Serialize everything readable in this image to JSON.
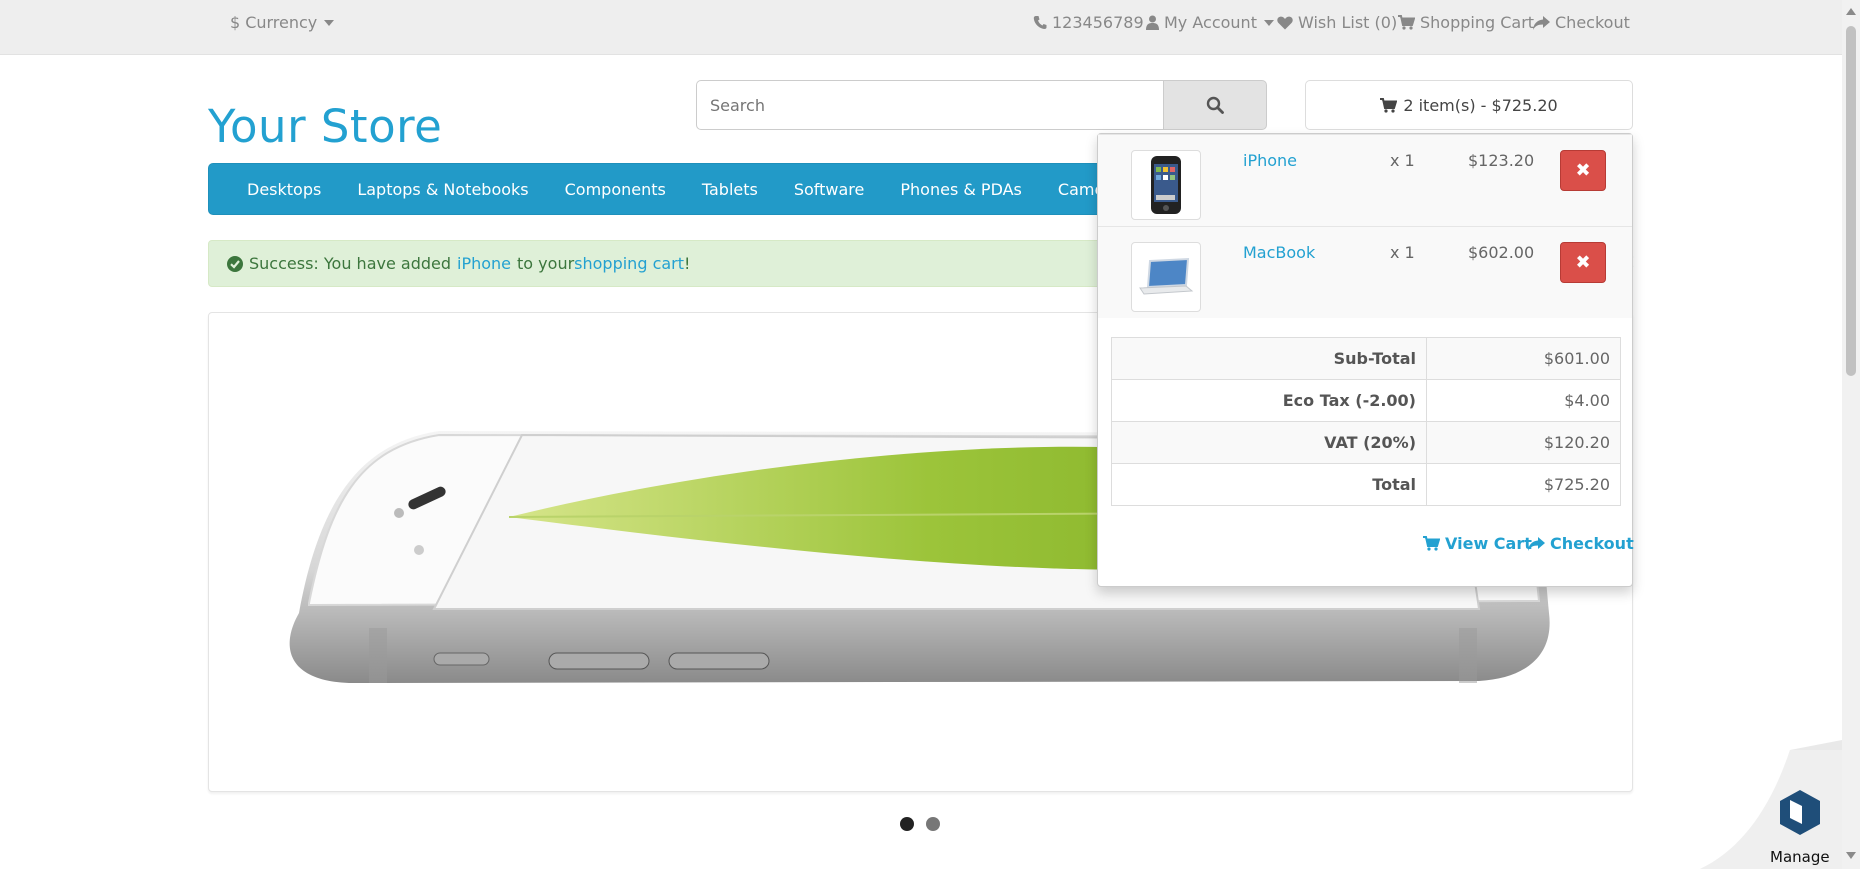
{
  "topbar": {
    "currency_label": "Currency",
    "currency_symbol": "$",
    "phone": "123456789",
    "my_account": "My Account",
    "wish_list": "Wish List (0)",
    "shopping_cart": "Shopping Cart",
    "checkout": "Checkout"
  },
  "header": {
    "logo": "Your Store",
    "search_placeholder": "Search",
    "cart_summary": "2 item(s) - $725.20"
  },
  "menu": {
    "items": [
      "Desktops",
      "Laptops & Notebooks",
      "Components",
      "Tablets",
      "Software",
      "Phones & PDAs",
      "Cameras"
    ]
  },
  "alert": {
    "prefix": "Success: You have added",
    "product": "iPhone",
    "middle": "to your",
    "cart_link": "shopping cart",
    "suffix": "!",
    "close": "×"
  },
  "cart": {
    "items": [
      {
        "name": "iPhone",
        "qty": "x 1",
        "price": "$123.20",
        "remove": "✖"
      },
      {
        "name": "MacBook",
        "qty": "x 1",
        "price": "$602.00",
        "remove": "✖"
      }
    ],
    "totals": [
      {
        "label": "Sub-Total",
        "value": "$601.00"
      },
      {
        "label": "Eco Tax (-2.00)",
        "value": "$4.00"
      },
      {
        "label": "VAT (20%)",
        "value": "$120.20"
      },
      {
        "label": "Total",
        "value": "$725.20"
      }
    ],
    "view_cart": "View Cart",
    "checkout": "Checkout"
  },
  "slideshow": {
    "active_index": 0,
    "slide_count": 2
  },
  "manage": {
    "label": "Manage"
  },
  "colors": {
    "accent": "#23a1d1",
    "nav": "#229ac8",
    "danger": "#da4f49",
    "success_bg": "#dff0d8"
  }
}
